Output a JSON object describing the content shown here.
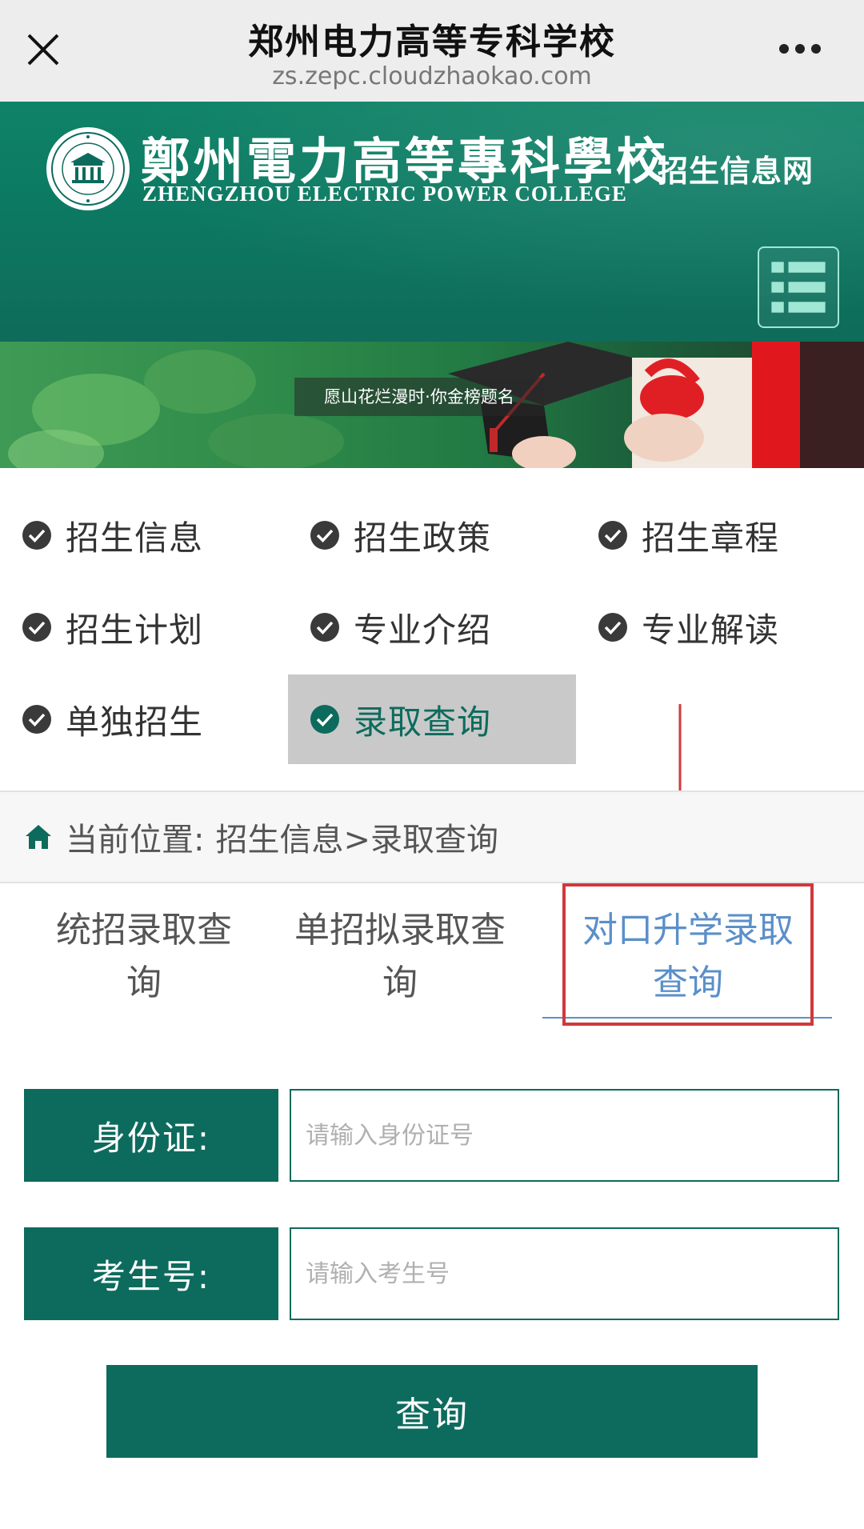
{
  "browser": {
    "title": "郑州电力高等专科学校",
    "url": "zs.zepc.cloudzhaokao.com"
  },
  "header": {
    "school_name_cn": "鄭州電力高等專科學校",
    "school_name_en": "ZHENGZHOU ELECTRIC POWER COLLEGE",
    "site_name": "招生信息网",
    "brand_color": "#0d6b5d"
  },
  "banner": {
    "slogan": "愿山花烂漫时·你金榜题名"
  },
  "nav": {
    "items": [
      {
        "label": "招生信息"
      },
      {
        "label": "招生政策"
      },
      {
        "label": "招生章程"
      },
      {
        "label": "招生计划"
      },
      {
        "label": "专业介绍"
      },
      {
        "label": "专业解读"
      },
      {
        "label": "单独招生"
      },
      {
        "label": "录取查询",
        "active": true
      }
    ]
  },
  "breadcrumb": {
    "prefix": "当前位置:",
    "path": "招生信息>录取查询"
  },
  "tabs": [
    {
      "line1": "统招录取查",
      "line2": "询"
    },
    {
      "line1": "单招拟录取查",
      "line2": "询"
    },
    {
      "line1": "对口升学录取",
      "line2": "查询",
      "active": true
    }
  ],
  "form": {
    "id_label": "身份证:",
    "id_placeholder": "请输入身份证号",
    "exam_label": "考生号:",
    "exam_placeholder": "请输入考生号",
    "submit_label": "查询"
  },
  "colors": {
    "accent": "#0d6b5d",
    "tab_active": "#5b8fc9",
    "annotation": "#d0393d"
  }
}
